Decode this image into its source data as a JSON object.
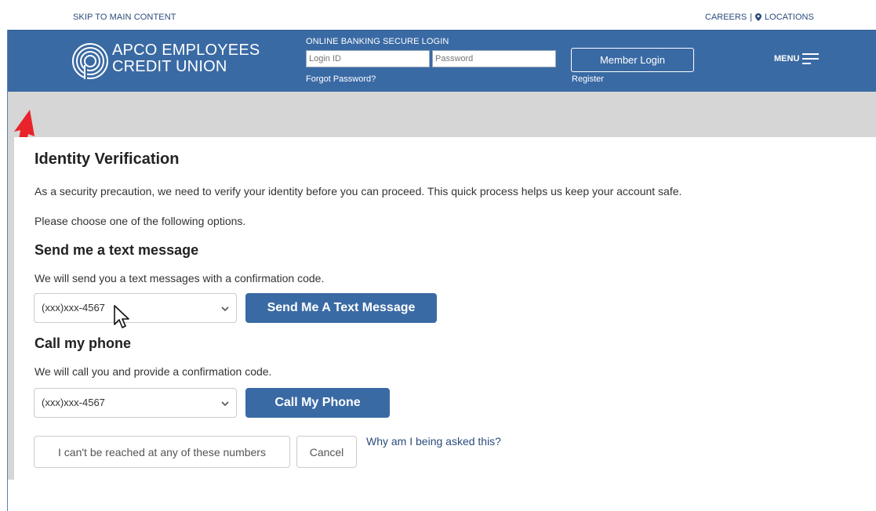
{
  "utility": {
    "skip_link": "SKIP TO MAIN CONTENT",
    "careers": "CAREERS",
    "separator": "|",
    "locations": "LOCATIONS"
  },
  "header": {
    "logo_line1": "APCO EMPLOYEES",
    "logo_line2": "CREDIT UNION",
    "login_title": "ONLINE BANKING SECURE LOGIN",
    "login_id_placeholder": "Login ID",
    "password_placeholder": "Password",
    "forgot_password": "Forgot Password?",
    "member_login": "Member Login",
    "register": "Register",
    "menu": "MENU"
  },
  "main": {
    "title": "Identity Verification",
    "intro": "As a security precaution, we need to verify your identity before you can proceed. This quick process helps us keep your account safe.",
    "choose": "Please choose one of the following options.",
    "text_section": {
      "heading": "Send me a text message",
      "description": "We will send you a text messages with a confirmation code.",
      "selected_number": "(xxx)xxx-4567",
      "button": "Send Me A Text Message"
    },
    "call_section": {
      "heading": "Call my phone",
      "description": "We will call you and provide a confirmation code.",
      "selected_number": "(xxx)xxx-4567",
      "button": "Call My Phone"
    },
    "cant_reach": "I can't be reached at any of these numbers",
    "cancel": "Cancel",
    "why_link": "Why am I being asked this?"
  },
  "colors": {
    "header_blue": "#3a6aa4",
    "link_blue": "#2a4b7c",
    "band_grey": "#d6d6d6",
    "arrow_red": "#e8232a"
  }
}
